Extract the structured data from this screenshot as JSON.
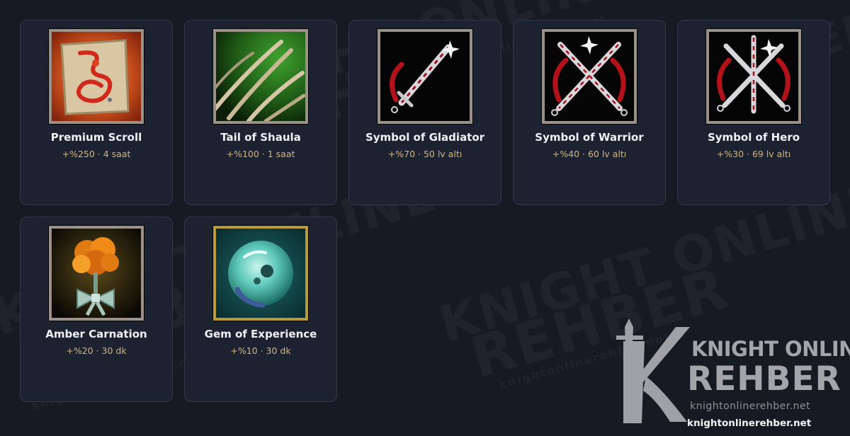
{
  "items": [
    {
      "name": "Premium Scroll",
      "desc": "+%250 · 4 saat",
      "icon": "premium-scroll-icon"
    },
    {
      "name": "Tail of Shaula",
      "desc": "+%100 · 1 saat",
      "icon": "tail-of-shaula-icon"
    },
    {
      "name": "Symbol of Gladiator",
      "desc": "+%70 · 50 lv altı",
      "icon": "symbol-of-gladiator-icon"
    },
    {
      "name": "Symbol of Warrior",
      "desc": "+%40 · 60 lv altı",
      "icon": "symbol-of-warrior-icon"
    },
    {
      "name": "Symbol of Hero",
      "desc": "+%30 · 69 lv altı",
      "icon": "symbol-of-hero-icon"
    },
    {
      "name": "Amber Carnation",
      "desc": "+%20 · 30 dk",
      "icon": "amber-carnation-icon"
    },
    {
      "name": "Gem of Experience",
      "desc": "+%10 · 30 dk",
      "icon": "gem-of-experience-icon"
    }
  ],
  "watermark": {
    "line1": "KNIGHT ONLINE",
    "line2": "REHBER",
    "url": "knightonlinerehber.net"
  },
  "logo": {
    "line1": "KNIGHT ONLINE",
    "line2": "REHBER",
    "url": "knightonlinerehber.net"
  },
  "footer_url": "knightonlinerehber.net",
  "colors": {
    "background": "#161a23",
    "card_background": "#1d2230",
    "card_border": "#313848",
    "title": "#eef0f4",
    "description": "#d4b47a",
    "gem_frame": "#b99a3a"
  }
}
